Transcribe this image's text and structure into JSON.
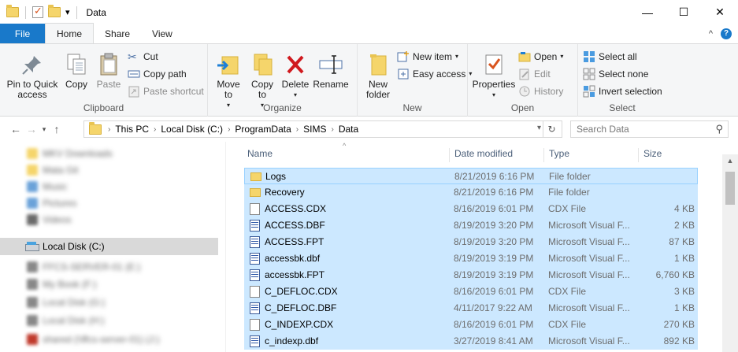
{
  "window": {
    "title": "Data",
    "minimize_glyph": "—",
    "maximize_glyph": "☐",
    "close_glyph": "✕"
  },
  "quick_access": {
    "dropdown_glyph": "▾"
  },
  "tabs": {
    "file": "File",
    "home": "Home",
    "share": "Share",
    "view": "View",
    "collapse_glyph": "^",
    "help_glyph": "?"
  },
  "ribbon": {
    "clipboard": {
      "group_label": "Clipboard",
      "pin_label": "Pin to Quick access",
      "copy_label": "Copy",
      "paste_label": "Paste",
      "cut_label": "Cut",
      "copy_path_label": "Copy path",
      "paste_shortcut_label": "Paste shortcut"
    },
    "organize": {
      "group_label": "Organize",
      "move_to_label": "Move to",
      "copy_to_label": "Copy to",
      "delete_label": "Delete",
      "rename_label": "Rename"
    },
    "new": {
      "group_label": "New",
      "new_folder_label": "New folder",
      "new_item_label": "New item",
      "easy_access_label": "Easy access"
    },
    "open": {
      "group_label": "Open",
      "properties_label": "Properties",
      "open_label": "Open",
      "edit_label": "Edit",
      "history_label": "History"
    },
    "select": {
      "group_label": "Select",
      "select_all_label": "Select all",
      "select_none_label": "Select none",
      "invert_selection_label": "Invert selection"
    }
  },
  "address": {
    "breadcrumb": [
      "This PC",
      "Local Disk (C:)",
      "ProgramData",
      "SIMS",
      "Data"
    ],
    "search_placeholder": "Search Data"
  },
  "nav_pane": {
    "items": [
      {
        "label": "MKV Downloads",
        "blurred": true,
        "color": "#f5d56b"
      },
      {
        "label": "Mata Git",
        "blurred": true,
        "color": "#f5d56b"
      },
      {
        "label": "Music",
        "blurred": true,
        "color": "#6aa2d9"
      },
      {
        "label": "Pictures",
        "blurred": true,
        "color": "#6aa2d9"
      },
      {
        "label": "Videos",
        "blurred": true,
        "color": "#6a6a6a"
      },
      {
        "label": "Local Disk (C:)",
        "blurred": false,
        "selected": true
      },
      {
        "label": "FFCS-SERVER-01 (E:)",
        "blurred": true,
        "color": "#888"
      },
      {
        "label": "My Book (F:)",
        "blurred": true,
        "color": "#888"
      },
      {
        "label": "Local Disk (G:)",
        "blurred": true,
        "color": "#888"
      },
      {
        "label": "Local Disk (H:)",
        "blurred": true,
        "color": "#888"
      },
      {
        "label": "Local Disk (I:)",
        "blurred": true,
        "color": "#888"
      },
      {
        "label": "shared (\\\\ffcs-server-01) (J:)",
        "blurred": true,
        "color": "#c0392b"
      }
    ]
  },
  "file_list": {
    "columns": {
      "name": "Name",
      "date": "Date modified",
      "type": "Type",
      "size": "Size"
    },
    "rows": [
      {
        "name": "Logs",
        "date": "8/21/2019 6:16 PM",
        "type": "File folder",
        "size": "",
        "icon": "folder"
      },
      {
        "name": "Recovery",
        "date": "8/21/2019 6:16 PM",
        "type": "File folder",
        "size": "",
        "icon": "folder"
      },
      {
        "name": "ACCESS.CDX",
        "date": "8/16/2019 6:01 PM",
        "type": "CDX File",
        "size": "4 KB",
        "icon": "doc"
      },
      {
        "name": "ACCESS.DBF",
        "date": "8/19/2019 3:20 PM",
        "type": "Microsoft Visual F...",
        "size": "2 KB",
        "icon": "db"
      },
      {
        "name": "ACCESS.FPT",
        "date": "8/19/2019 3:20 PM",
        "type": "Microsoft Visual F...",
        "size": "87 KB",
        "icon": "db"
      },
      {
        "name": "accessbk.dbf",
        "date": "8/19/2019 3:19 PM",
        "type": "Microsoft Visual F...",
        "size": "1 KB",
        "icon": "db"
      },
      {
        "name": "accessbk.FPT",
        "date": "8/19/2019 3:19 PM",
        "type": "Microsoft Visual F...",
        "size": "6,760 KB",
        "icon": "db"
      },
      {
        "name": "C_DEFLOC.CDX",
        "date": "8/16/2019 6:01 PM",
        "type": "CDX File",
        "size": "3 KB",
        "icon": "doc"
      },
      {
        "name": "C_DEFLOC.DBF",
        "date": "4/11/2017 9:22 AM",
        "type": "Microsoft Visual F...",
        "size": "1 KB",
        "icon": "db"
      },
      {
        "name": "C_INDEXP.CDX",
        "date": "8/16/2019 6:01 PM",
        "type": "CDX File",
        "size": "270 KB",
        "icon": "doc"
      },
      {
        "name": "c_indexp.dbf",
        "date": "3/27/2019 8:41 AM",
        "type": "Microsoft Visual F...",
        "size": "892 KB",
        "icon": "db"
      }
    ]
  },
  "colors": {
    "file_tab": "#1979ca",
    "selection": "#cce8ff",
    "selection_border": "#99d1ff"
  }
}
